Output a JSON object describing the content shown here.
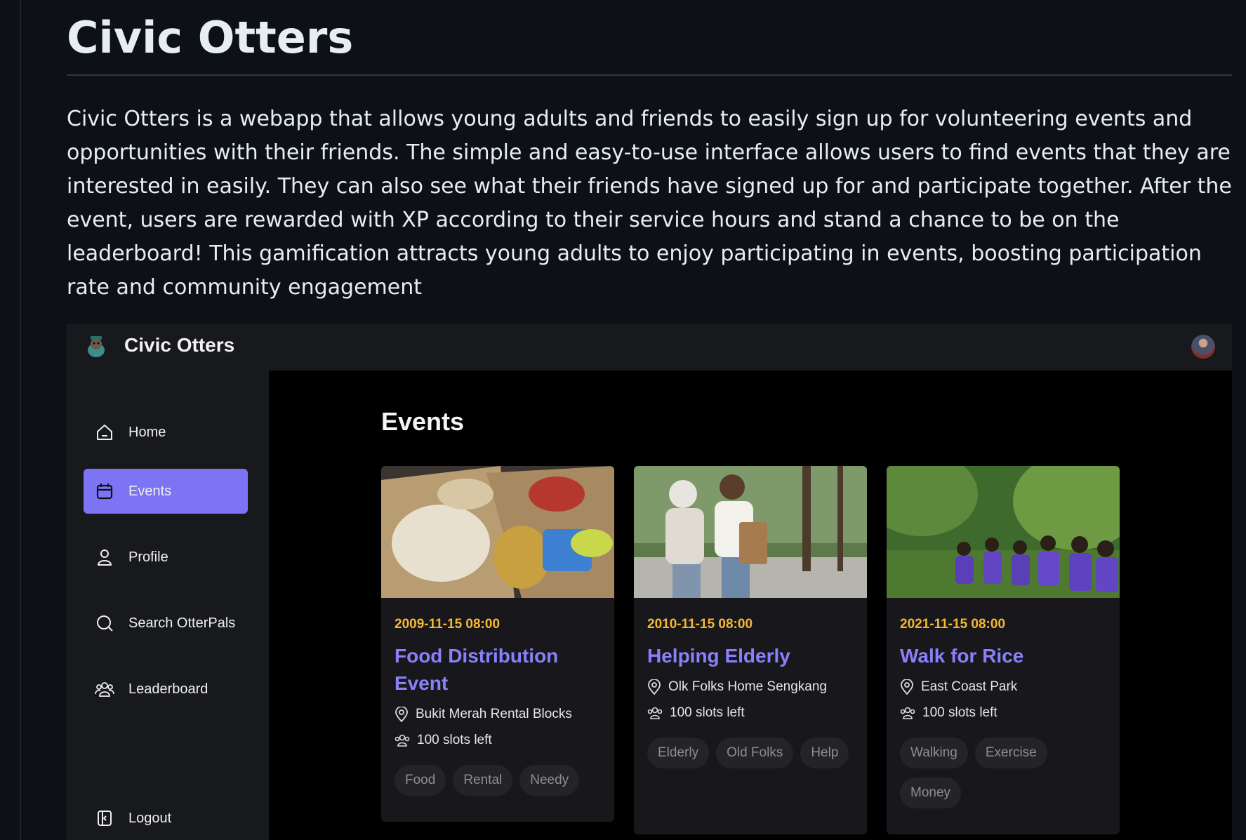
{
  "readme": {
    "title": "Civic Otters",
    "description": "Civic Otters is a webapp that allows young adults and friends to easily sign up for volunteering events and opportunities with their friends. The simple and easy-to-use interface allows users to find events that they are interested in easily. They can also see what their friends have signed up for and participate together. After the event, users are rewarded with XP according to their service hours and stand a chance to be on the leaderboard! This gamification attracts young adults to enjoy participating in events, boosting participation rate and community engagement"
  },
  "app": {
    "brand": "Civic Otters",
    "accent_color": "#7c74f5",
    "date_color": "#f5b831",
    "title_color": "#8a80fb",
    "sidebar": {
      "items": [
        {
          "label": "Home",
          "icon": "home-icon"
        },
        {
          "label": "Events",
          "icon": "calendar-icon",
          "active": true
        },
        {
          "label": "Profile",
          "icon": "user-icon"
        },
        {
          "label": "Search OtterPals",
          "icon": "search-icon"
        },
        {
          "label": "Leaderboard",
          "icon": "users-icon"
        }
      ],
      "logout": {
        "label": "Logout",
        "icon": "logout-icon"
      }
    },
    "page_title": "Events",
    "events": [
      {
        "date": "2009-11-15 08:00",
        "title": "Food Distribution Event",
        "location": "Bukit Merah Rental Blocks",
        "slots": "100 slots left",
        "tags": [
          "Food",
          "Rental",
          "Needy"
        ],
        "image": "food-boxes"
      },
      {
        "date": "2010-11-15 08:00",
        "title": "Helping Elderly",
        "location": "Olk Folks Home Sengkang",
        "slots": "100 slots left",
        "tags": [
          "Elderly",
          "Old Folks",
          "Help"
        ],
        "image": "elderly-walk"
      },
      {
        "date": "2021-11-15 08:00",
        "title": "Walk for Rice",
        "location": "East Coast Park",
        "slots": "100 slots left",
        "tags": [
          "Walking",
          "Exercise",
          "Money"
        ],
        "image": "park-walk"
      }
    ]
  }
}
